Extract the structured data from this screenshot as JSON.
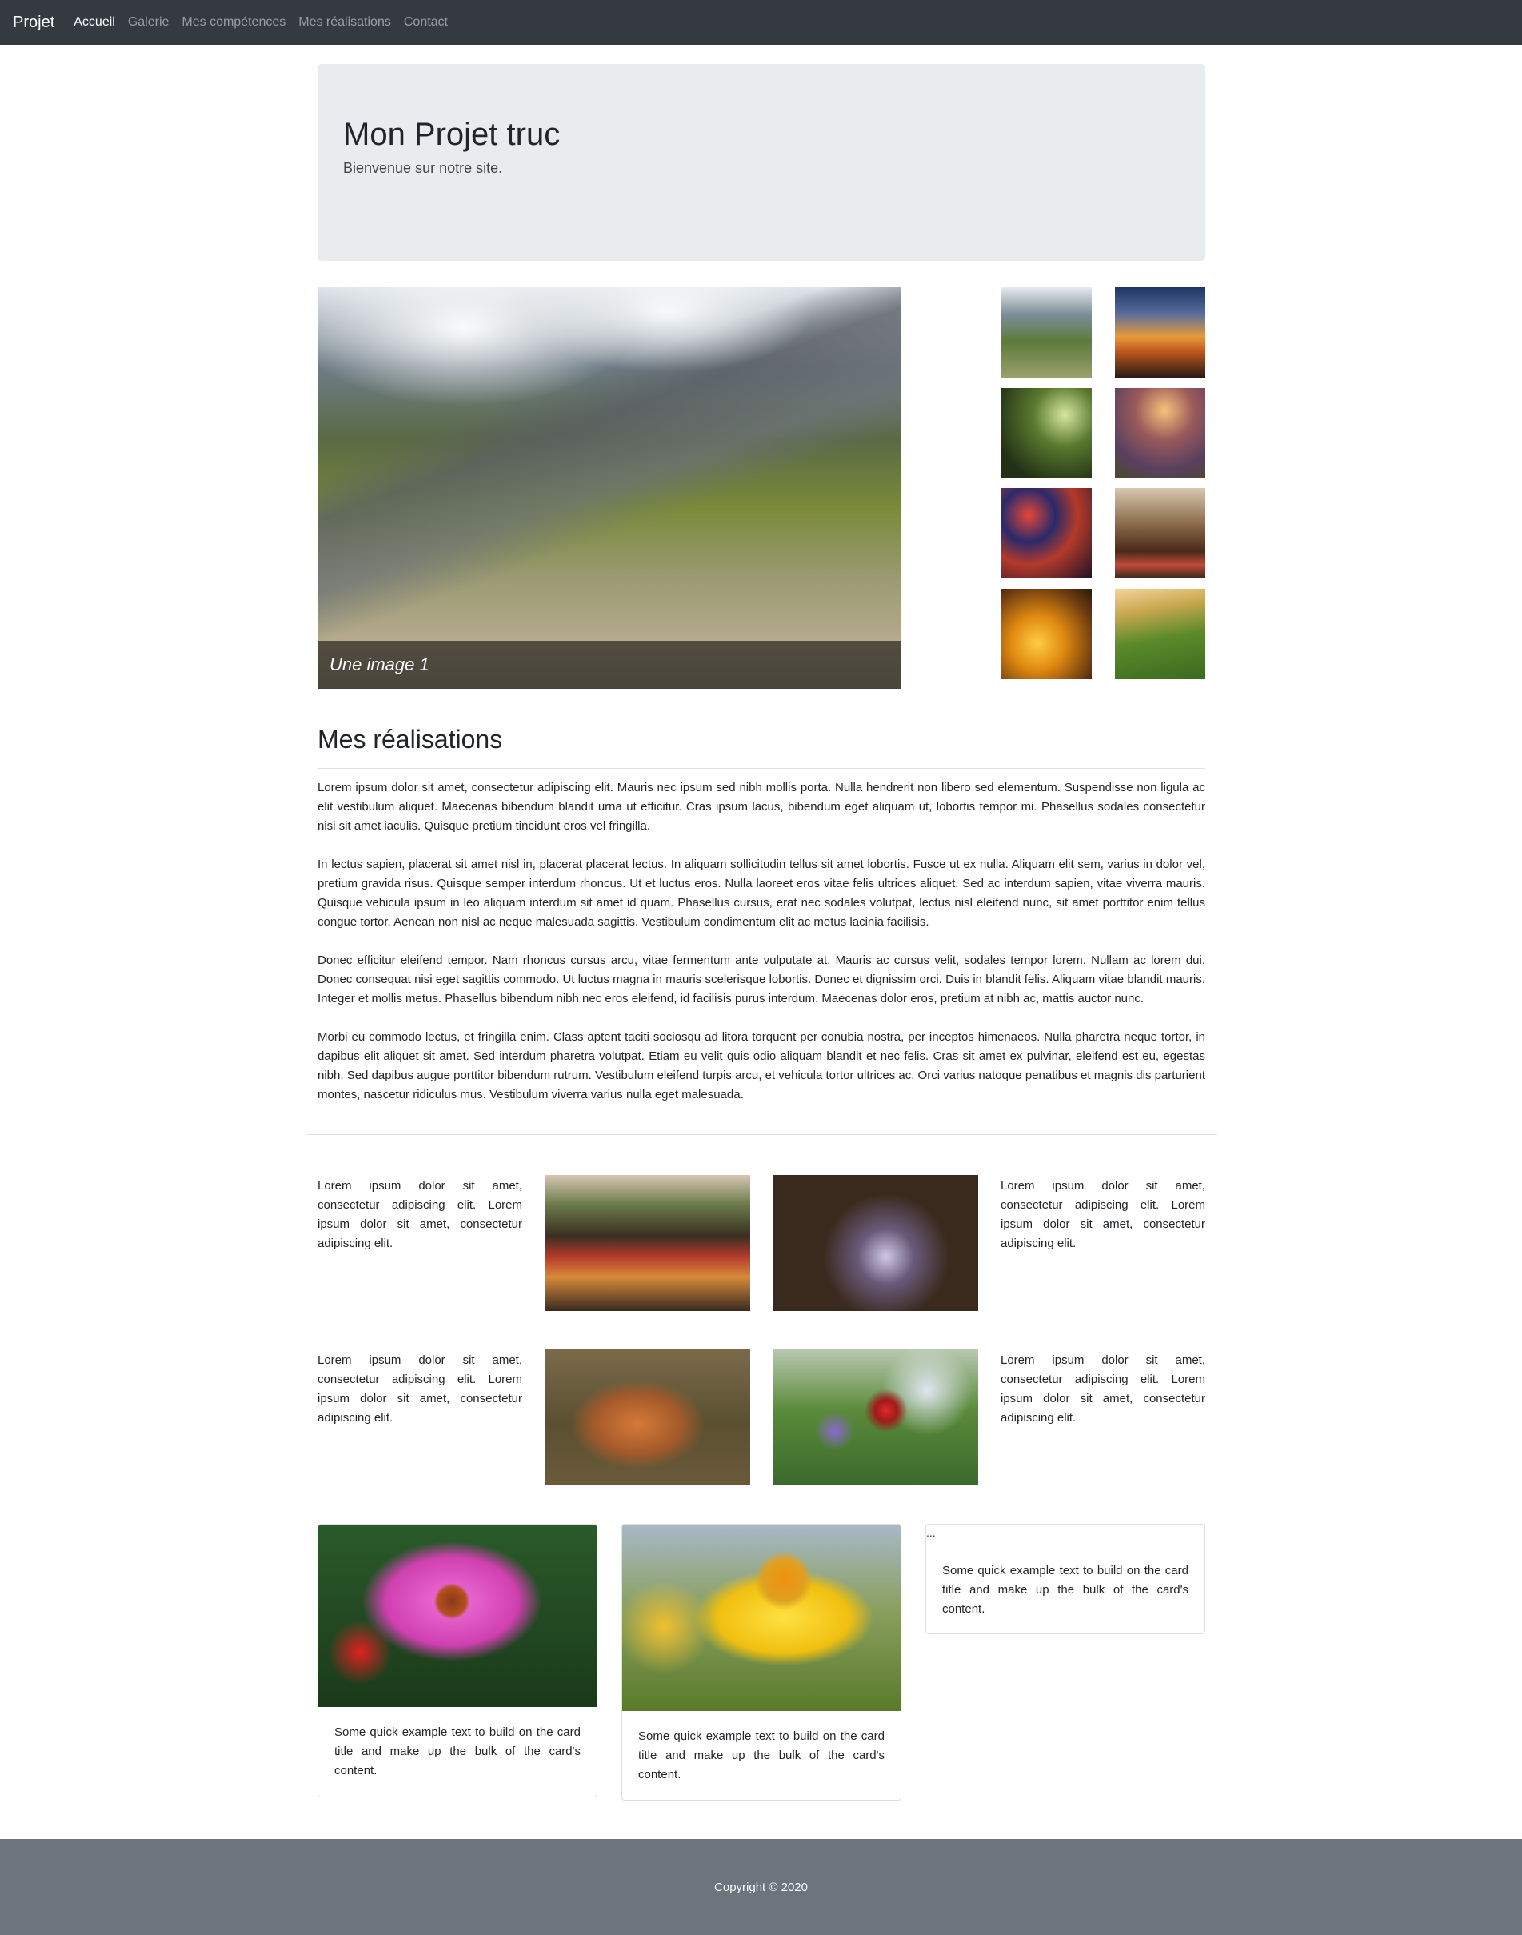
{
  "navbar": {
    "brand": "Projet",
    "links": [
      "Accueil",
      "Galerie",
      "Mes compétences",
      "Mes réalisations",
      "Contact"
    ]
  },
  "jumbotron": {
    "title": "Mon Projet truc",
    "lead": "Bienvenue sur notre site."
  },
  "carousel": {
    "caption": "Une image 1"
  },
  "realisations": {
    "title": "Mes réalisations",
    "paragraphs": [
      "Lorem ipsum dolor sit amet, consectetur adipiscing elit. Mauris nec ipsum sed nibh mollis porta. Nulla hendrerit non libero sed elementum. Suspendisse non ligula ac elit vestibulum aliquet. Maecenas bibendum blandit urna ut efficitur. Cras ipsum lacus, bibendum eget aliquam ut, lobortis tempor mi. Phasellus sodales consectetur nisi sit amet iaculis. Quisque pretium tincidunt eros vel fringilla.",
      "In lectus sapien, placerat sit amet nisl in, placerat placerat lectus. In aliquam sollicitudin tellus sit amet lobortis. Fusce ut ex nulla. Aliquam elit sem, varius in dolor vel, pretium gravida risus. Quisque semper interdum rhoncus. Ut et luctus eros. Nulla laoreet eros vitae felis ultrices aliquet. Sed ac interdum sapien, vitae viverra mauris. Quisque vehicula ipsum in leo aliquam interdum sit amet id quam. Phasellus cursus, erat nec sodales volutpat, lectus nisl eleifend nunc, sit amet porttitor enim tellus congue tortor. Aenean non nisl ac neque malesuada sagittis. Vestibulum condimentum elit ac metus lacinia facilisis.",
      "Donec efficitur eleifend tempor. Nam rhoncus cursus arcu, vitae fermentum ante vulputate at. Mauris ac cursus velit, sodales tempor lorem. Nullam ac lorem dui. Donec consequat nisi eget sagittis commodo. Ut luctus magna in mauris scelerisque lobortis. Donec et dignissim orci. Duis in blandit felis. Aliquam vitae blandit mauris. Integer et mollis metus. Phasellus bibendum nibh nec eros eleifend, id facilisis purus interdum. Maecenas dolor eros, pretium at nibh ac, mattis auctor nunc.",
      "Morbi eu commodo lectus, et fringilla enim. Class aptent taciti sociosqu ad litora torquent per conubia nostra, per inceptos himenaeos. Nulla pharetra neque tortor, in dapibus elit aliquet sit amet. Sed interdum pharetra volutpat. Etiam eu velit quis odio aliquam blandit et nec felis. Cras sit amet ex pulvinar, eleifend est eu, egestas nibh. Sed dapibus augue porttitor bibendum rutrum. Vestibulum eleifend turpis arcu, et vehicula tortor ultrices ac. Orci varius natoque penatibus et magnis dis parturient montes, nascetur ridiculus mus. Vestibulum viverra varius nulla eget malesuada."
    ]
  },
  "grid": {
    "text": "Lorem ipsum dolor sit amet, consectetur adipiscing elit. Lorem ipsum dolor sit amet, consectetur adipiscing elit."
  },
  "cards": {
    "text": "Some quick example text to build on the card title and make up the bulk of the card's content.",
    "broken_image_alt": "..."
  },
  "footer": {
    "copyright": "Copyright © 2020"
  }
}
